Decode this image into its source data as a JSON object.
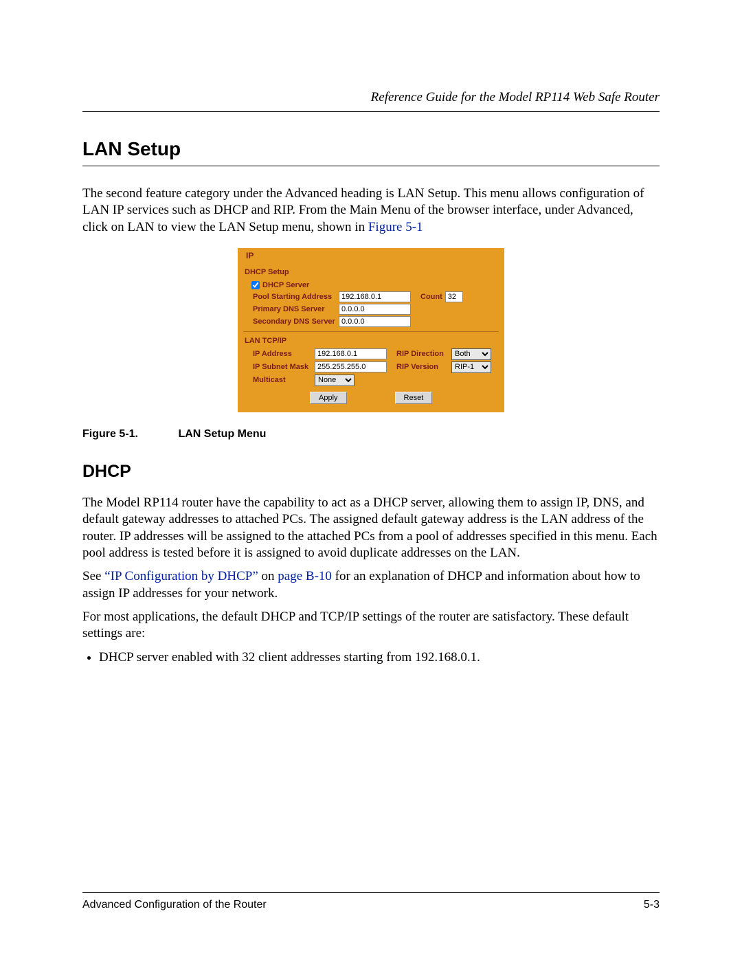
{
  "header": {
    "running": "Reference Guide for the Model RP114 Web Safe Router"
  },
  "section": {
    "title": "LAN Setup",
    "intro_a": "The second feature category under the Advanced heading is LAN Setup. This menu allows configuration of LAN IP services such as DHCP and RIP. From the Main Menu of the browser interface, under Advanced, click on LAN to view the LAN Setup menu, shown in ",
    "intro_link": "Figure 5-1"
  },
  "figure": {
    "tab": "IP",
    "dhcp_header": "DHCP Setup",
    "dhcp_server_label": "DHCP Server",
    "dhcp_server_checked": true,
    "pool_label": "Pool Starting Address",
    "pool_value": "192.168.0.1",
    "count_label": "Count",
    "count_value": "32",
    "pdns_label": "Primary DNS Server",
    "pdns_value": "0.0.0.0",
    "sdns_label": "Secondary DNS Server",
    "sdns_value": "0.0.0.0",
    "lan_header": "LAN TCP/IP",
    "ipaddr_label": "IP Address",
    "ipaddr_value": "192.168.0.1",
    "ripdir_label": "RIP Direction",
    "ripdir_value": "Both",
    "subnet_label": "IP Subnet Mask",
    "subnet_value": "255.255.255.0",
    "ripver_label": "RIP Version",
    "ripver_value": "RIP-1",
    "multicast_label": "Multicast",
    "multicast_value": "None",
    "apply": "Apply",
    "reset": "Reset",
    "caption_no": "Figure 5-1.",
    "caption_text": "LAN Setup Menu"
  },
  "dhcp": {
    "title": "DHCP",
    "p1": "The Model RP114 router have the capability to act as a DHCP server, allowing them to assign IP, DNS, and default gateway addresses to attached PCs. The assigned default gateway address is the LAN address of the router. IP addresses will be assigned to the attached PCs from a pool of addresses specified in this menu. Each pool address is tested before it is assigned to avoid duplicate addresses on the LAN.",
    "p2_a": "See ",
    "p2_link1": "“IP Configuration by DHCP”",
    "p2_b": " on ",
    "p2_link2": "page B-10",
    "p2_c": " for an explanation of DHCP and information about how to assign IP addresses for your network.",
    "p3": "For most applications, the default DHCP and TCP/IP settings of the router are satisfactory. These default settings are:",
    "bullet1": "DHCP server enabled with 32 client addresses starting from 192.168.0.1."
  },
  "footer": {
    "left": "Advanced Configuration of the Router",
    "right": "5-3"
  }
}
